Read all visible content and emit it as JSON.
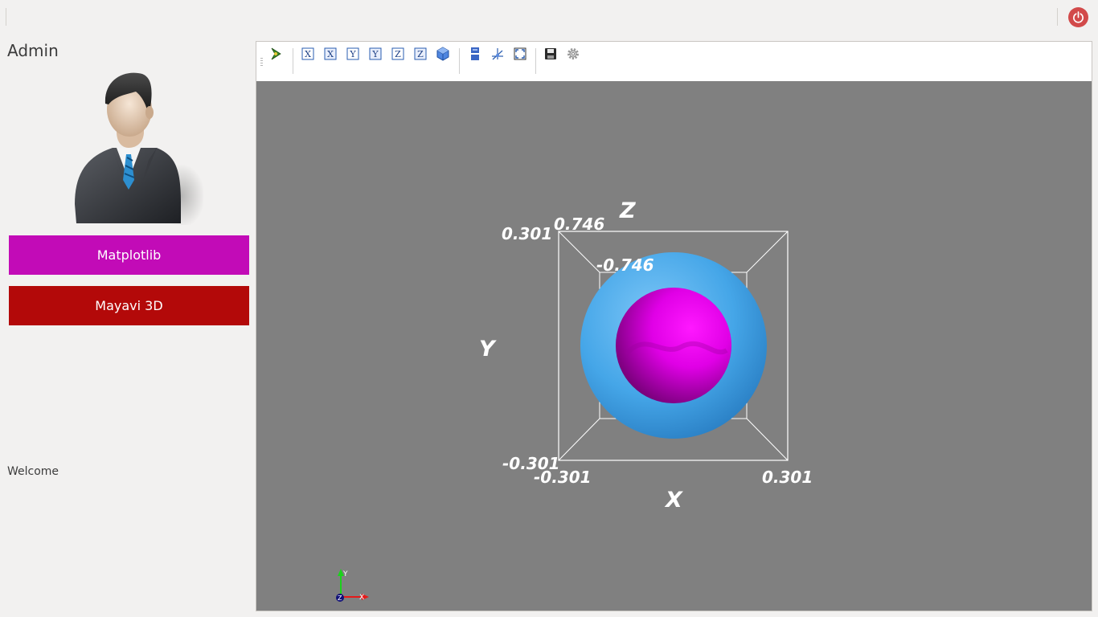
{
  "window": {
    "power_icon": "power-icon",
    "accent_colors": {
      "matplotlib_button": "#c20bb7",
      "mayavi_button": "#b30909",
      "power": "#d24a4a"
    }
  },
  "sidebar": {
    "user_name": "Admin",
    "avatar_icon": "businessman-avatar",
    "buttons": {
      "matplotlib": "Matplotlib",
      "mayavi": "Mayavi 3D"
    },
    "welcome": "Welcome"
  },
  "toolbar": {
    "icons": [
      "mayavi-pipeline-icon",
      "view-x-plus-icon",
      "view-x-minus-icon",
      "view-y-plus-icon",
      "view-y-minus-icon",
      "view-z-plus-icon",
      "view-z-minus-icon",
      "isometric-view-icon",
      "parallel-projection-icon",
      "axes-toggle-icon",
      "fullscreen-icon",
      "save-icon",
      "configure-icon"
    ]
  },
  "scene": {
    "background": "#808080",
    "axis_labels": {
      "x": "X",
      "y": "Y",
      "z": "Z"
    },
    "ticks": {
      "x_min": "-0.301",
      "x_max": "0.301",
      "y_min": "-0.301",
      "y_max": "0.301",
      "z_max": "0.746",
      "z_min": "-0.746"
    },
    "objects": [
      {
        "name": "outer torus",
        "color": "#4aa9e8"
      },
      {
        "name": "inner sphere",
        "color": "#e000e6"
      }
    ],
    "orientation_axes": {
      "x": "X",
      "y": "Y",
      "z": "Z"
    }
  }
}
